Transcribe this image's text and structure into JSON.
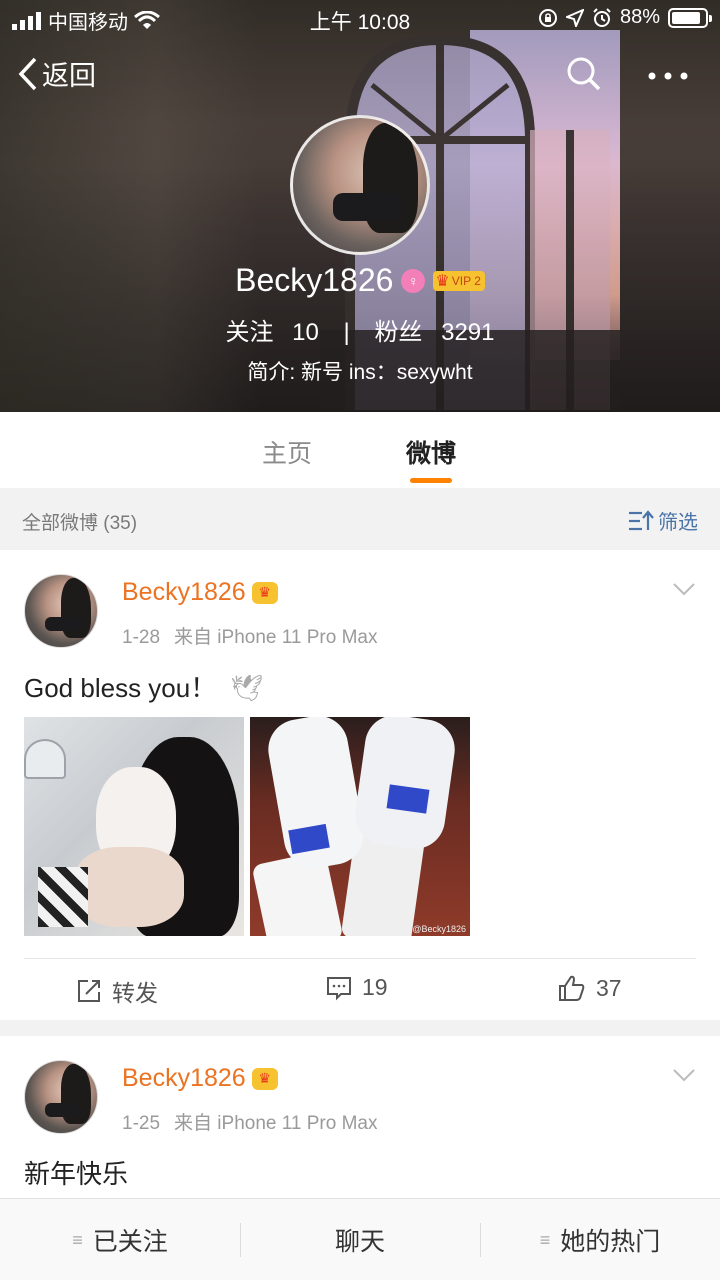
{
  "status_bar": {
    "carrier": "中国移动",
    "time": "上午 10:08",
    "battery": "88%",
    "battery_level": 0.88
  },
  "nav": {
    "back_label": "返回"
  },
  "profile": {
    "name": "Becky1826",
    "vip_label": "VIP 2",
    "following_label": "关注",
    "following_count": "10",
    "separator": "|",
    "followers_label": "粉丝",
    "followers_count": "3291",
    "bio": "简介: 新号  ins：sexywht"
  },
  "tabs": {
    "home": "主页",
    "weibo": "微博"
  },
  "filter": {
    "count_label": "全部微博 (35)",
    "filter_label": "筛选"
  },
  "posts": [
    {
      "author": "Becky1826",
      "date": "1-28",
      "source": "来自 iPhone 11 Pro Max",
      "text": "God bless you！",
      "watermark": "@Becky1826",
      "repost_label": "转发",
      "comments": "19",
      "likes": "37"
    },
    {
      "author": "Becky1826",
      "date": "1-25",
      "source": "来自 iPhone 11 Pro Max",
      "text": "新年快乐"
    }
  ],
  "bottom_bar": {
    "followed": "已关注",
    "chat": "聊天",
    "hot": "她的热门"
  },
  "colors": {
    "accent_orange": "#ff8200",
    "name_orange": "#eb7322",
    "link_blue": "#4a74a8"
  }
}
